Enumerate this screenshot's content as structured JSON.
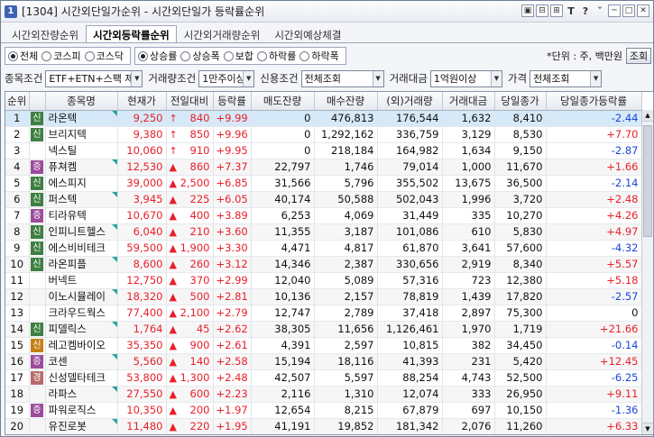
{
  "window": {
    "number": "1",
    "title": "[1304] 시간외단일가순위 - 시간외단일가 등락률순위",
    "tools": [
      "▣",
      "⊟",
      "⊞",
      "T",
      "?",
      "ˇ",
      "─",
      "□",
      "✕"
    ]
  },
  "tabs": [
    {
      "label": "시간외잔량순위",
      "active": false
    },
    {
      "label": "시간외등락률순위",
      "active": true
    },
    {
      "label": "시간외거래량순위",
      "active": false
    },
    {
      "label": "시간외예상체결",
      "active": false
    }
  ],
  "market_radios": [
    {
      "label": "전체",
      "checked": true
    },
    {
      "label": "코스피",
      "checked": false
    },
    {
      "label": "코스닥",
      "checked": false
    }
  ],
  "direction_radios": [
    {
      "label": "상승률",
      "checked": true
    },
    {
      "label": "상승폭",
      "checked": false
    },
    {
      "label": "보합",
      "checked": false
    },
    {
      "label": "하락률",
      "checked": false
    },
    {
      "label": "하락폭",
      "checked": false
    }
  ],
  "unit_text": "*단위 : 주, 백만원",
  "query_button": "조회",
  "filters": {
    "item_label": "종목조건",
    "item_value": "ETF+ETN+스팩 제",
    "volume_label": "거래량조건",
    "volume_value": "1만주이상",
    "credit_label": "신용조건",
    "credit_value": "전체조회",
    "amount_label": "거래대금",
    "amount_value": "1억원이상",
    "price_label": "가격",
    "price_value": "전체조회"
  },
  "columns": [
    "순위",
    "",
    "종목명",
    "현재가",
    "전일대비",
    "등락률",
    "매도잔량",
    "매수잔량",
    "(외)거래량",
    "거래대금",
    "당일종가",
    "당일종가등락률"
  ],
  "colors": {
    "up": "#e8202a",
    "down": "#1a47d6",
    "badge_credit": "#3f7f43",
    "badge_margin": "#9b4c9b",
    "badge_amber": "#c47f15",
    "badge_kosdaq": "#5b8b5e"
  },
  "rows": [
    {
      "rank": "1",
      "mark": "신",
      "mark_color": "#3f7f43",
      "name": "라온텍",
      "price": "9,250",
      "arrow": "↑",
      "diff": "840",
      "rate": "+9.99",
      "ask": "0",
      "bid": "476,813",
      "volume": "176,544",
      "amount": "1,632",
      "close": "8,410",
      "close_rate": "-2.44",
      "close_dir": "dn",
      "tri": true
    },
    {
      "rank": "2",
      "mark": "신",
      "mark_color": "#3f7f43",
      "name": "브리지텍",
      "price": "9,380",
      "arrow": "↑",
      "diff": "850",
      "rate": "+9.96",
      "ask": "0",
      "bid": "1,292,162",
      "volume": "336,759",
      "amount": "3,129",
      "close": "8,530",
      "close_rate": "+7.70",
      "close_dir": "up",
      "tri": false
    },
    {
      "rank": "3",
      "mark": "",
      "mark_color": "",
      "name": "넥스틸",
      "price": "10,060",
      "arrow": "↑",
      "diff": "910",
      "rate": "+9.95",
      "ask": "0",
      "bid": "218,184",
      "volume": "164,982",
      "amount": "1,634",
      "close": "9,150",
      "close_rate": "-2.87",
      "close_dir": "dn",
      "tri": false
    },
    {
      "rank": "4",
      "mark": "증",
      "mark_color": "#9b4c9b",
      "name": "퓨쳐켐",
      "price": "12,530",
      "arrow": "▲",
      "diff": "860",
      "rate": "+7.37",
      "ask": "22,797",
      "bid": "1,746",
      "volume": "79,014",
      "amount": "1,000",
      "close": "11,670",
      "close_rate": "+1.66",
      "close_dir": "up",
      "tri": true
    },
    {
      "rank": "5",
      "mark": "신",
      "mark_color": "#3f7f43",
      "name": "에스피지",
      "price": "39,000",
      "arrow": "▲",
      "diff": "2,500",
      "rate": "+6.85",
      "ask": "31,566",
      "bid": "5,796",
      "volume": "355,502",
      "amount": "13,675",
      "close": "36,500",
      "close_rate": "-2.14",
      "close_dir": "dn",
      "tri": false
    },
    {
      "rank": "6",
      "mark": "신",
      "mark_color": "#3f7f43",
      "name": "퍼스텍",
      "price": "3,945",
      "arrow": "▲",
      "diff": "225",
      "rate": "+6.05",
      "ask": "40,174",
      "bid": "50,588",
      "volume": "502,043",
      "amount": "1,996",
      "close": "3,720",
      "close_rate": "+2.48",
      "close_dir": "up",
      "tri": true
    },
    {
      "rank": "7",
      "mark": "증",
      "mark_color": "#9b4c9b",
      "name": "티라유텍",
      "price": "10,670",
      "arrow": "▲",
      "diff": "400",
      "rate": "+3.89",
      "ask": "6,253",
      "bid": "4,069",
      "volume": "31,449",
      "amount": "335",
      "close": "10,270",
      "close_rate": "+4.26",
      "close_dir": "up",
      "tri": false
    },
    {
      "rank": "8",
      "mark": "신",
      "mark_color": "#3f7f43",
      "name": "인피니트헬스",
      "price": "6,040",
      "arrow": "▲",
      "diff": "210",
      "rate": "+3.60",
      "ask": "11,355",
      "bid": "3,187",
      "volume": "101,086",
      "amount": "610",
      "close": "5,830",
      "close_rate": "+4.97",
      "close_dir": "up",
      "tri": true
    },
    {
      "rank": "9",
      "mark": "신",
      "mark_color": "#3f7f43",
      "name": "에스비비테크",
      "price": "59,500",
      "arrow": "▲",
      "diff": "1,900",
      "rate": "+3.30",
      "ask": "4,471",
      "bid": "4,817",
      "volume": "61,870",
      "amount": "3,641",
      "close": "57,600",
      "close_rate": "-4.32",
      "close_dir": "dn",
      "tri": false
    },
    {
      "rank": "10",
      "mark": "신",
      "mark_color": "#3f7f43",
      "name": "라온피플",
      "price": "8,600",
      "arrow": "▲",
      "diff": "260",
      "rate": "+3.12",
      "ask": "14,346",
      "bid": "2,387",
      "volume": "330,656",
      "amount": "2,919",
      "close": "8,340",
      "close_rate": "+5.57",
      "close_dir": "up",
      "tri": true
    },
    {
      "rank": "11",
      "mark": "",
      "mark_color": "",
      "name": "버넥트",
      "price": "12,750",
      "arrow": "▲",
      "diff": "370",
      "rate": "+2.99",
      "ask": "12,040",
      "bid": "5,089",
      "volume": "57,316",
      "amount": "723",
      "close": "12,380",
      "close_rate": "+5.18",
      "close_dir": "up",
      "tri": false
    },
    {
      "rank": "12",
      "mark": "",
      "mark_color": "",
      "name": "이노시뮬레이",
      "price": "18,320",
      "arrow": "▲",
      "diff": "500",
      "rate": "+2.81",
      "ask": "10,136",
      "bid": "2,157",
      "volume": "78,819",
      "amount": "1,439",
      "close": "17,820",
      "close_rate": "-2.57",
      "close_dir": "dn",
      "tri": true
    },
    {
      "rank": "13",
      "mark": "",
      "mark_color": "",
      "name": "크라우드웍스",
      "price": "77,400",
      "arrow": "▲",
      "diff": "2,100",
      "rate": "+2.79",
      "ask": "12,747",
      "bid": "2,789",
      "volume": "37,418",
      "amount": "2,897",
      "close": "75,300",
      "close_rate": "0",
      "close_dir": "flat",
      "tri": false
    },
    {
      "rank": "14",
      "mark": "신",
      "mark_color": "#3f7f43",
      "name": "피델릭스",
      "price": "1,764",
      "arrow": "▲",
      "diff": "45",
      "rate": "+2.62",
      "ask": "38,305",
      "bid": "11,656",
      "volume": "1,126,461",
      "amount": "1,970",
      "close": "1,719",
      "close_rate": "+21.66",
      "close_dir": "up",
      "tri": true
    },
    {
      "rank": "15",
      "mark": "신",
      "mark_color": "#c47f15",
      "name": "레고켐바이오",
      "price": "35,350",
      "arrow": "▲",
      "diff": "900",
      "rate": "+2.61",
      "ask": "4,391",
      "bid": "2,597",
      "volume": "10,815",
      "amount": "382",
      "close": "34,450",
      "close_rate": "-0.14",
      "close_dir": "dn",
      "tri": false
    },
    {
      "rank": "16",
      "mark": "증",
      "mark_color": "#9b4c9b",
      "name": "코센",
      "price": "5,560",
      "arrow": "▲",
      "diff": "140",
      "rate": "+2.58",
      "ask": "15,194",
      "bid": "18,116",
      "volume": "41,393",
      "amount": "231",
      "close": "5,420",
      "close_rate": "+12.45",
      "close_dir": "up",
      "tri": true
    },
    {
      "rank": "17",
      "mark": "경",
      "mark_color": "#b86a6a",
      "name": "신성델타테크",
      "price": "53,800",
      "arrow": "▲",
      "diff": "1,300",
      "rate": "+2.48",
      "ask": "42,507",
      "bid": "5,597",
      "volume": "88,254",
      "amount": "4,743",
      "close": "52,500",
      "close_rate": "-6.25",
      "close_dir": "dn",
      "tri": false
    },
    {
      "rank": "18",
      "mark": "",
      "mark_color": "",
      "name": "라파스",
      "price": "27,550",
      "arrow": "▲",
      "diff": "600",
      "rate": "+2.23",
      "ask": "2,116",
      "bid": "1,310",
      "volume": "12,074",
      "amount": "333",
      "close": "26,950",
      "close_rate": "+9.11",
      "close_dir": "up",
      "tri": true
    },
    {
      "rank": "19",
      "mark": "증",
      "mark_color": "#9b4c9b",
      "name": "파워로직스",
      "price": "10,350",
      "arrow": "▲",
      "diff": "200",
      "rate": "+1.97",
      "ask": "12,654",
      "bid": "8,215",
      "volume": "67,879",
      "amount": "697",
      "close": "10,150",
      "close_rate": "-1.36",
      "close_dir": "dn",
      "tri": false
    },
    {
      "rank": "20",
      "mark": "",
      "mark_color": "",
      "name": "유진로봇",
      "price": "11,480",
      "arrow": "▲",
      "diff": "220",
      "rate": "+1.95",
      "ask": "41,191",
      "bid": "19,852",
      "volume": "181,342",
      "amount": "2,076",
      "close": "11,260",
      "close_rate": "+6.33",
      "close_dir": "up",
      "tri": true
    }
  ]
}
